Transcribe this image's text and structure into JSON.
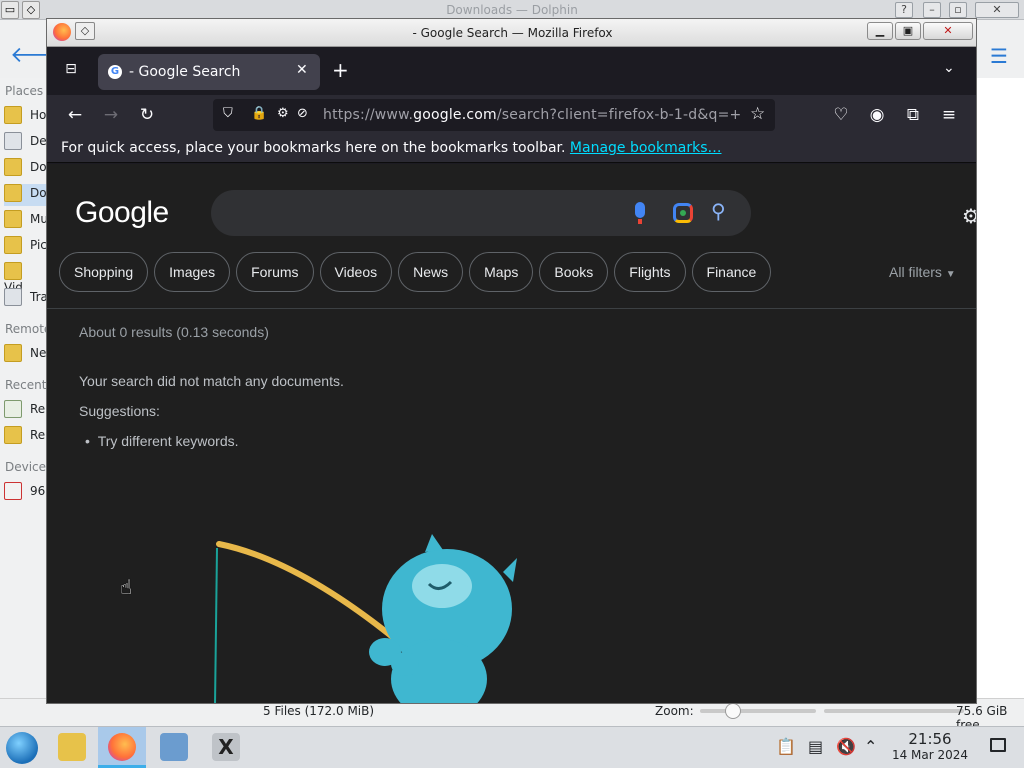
{
  "dolphin": {
    "title": "Downloads — Dolphin",
    "places_header": "Places",
    "remote_header": "Remote",
    "recent_header": "Recent",
    "devices_header": "Devices",
    "places": [
      "Ho",
      "De",
      "Do",
      "Do",
      "Mu",
      "Pic",
      "Vid",
      "Tra"
    ],
    "remote": [
      "Ne"
    ],
    "recent": [
      "Re",
      "Re"
    ],
    "devices": [
      "96"
    ],
    "status_files": "5 Files (172.0 MiB)",
    "zoom_label": "Zoom:",
    "free_space": "75.6 GiB free"
  },
  "firefox": {
    "window_title": "- Google Search — Mozilla Firefox",
    "tab_label": "- Google Search",
    "url_prefix": "https://www.",
    "url_domain": "google.com",
    "url_rest": "/search?client=firefox-b-1-d&q=+",
    "bookmarks_message": "For quick access, place your bookmarks here on the bookmarks toolbar.",
    "manage_bookmarks": "Manage bookmarks…"
  },
  "google": {
    "logo": "Google",
    "chips": [
      "Shopping",
      "Images",
      "Forums",
      "Videos",
      "News",
      "Maps",
      "Books",
      "Flights",
      "Finance"
    ],
    "all_filters": "All filters",
    "stats": "About 0 results (0.13 seconds)",
    "no_match": "Your search did not match any documents.",
    "suggestions_label": "Suggestions:",
    "suggestion_1": "Try different keywords."
  },
  "taskbar": {
    "time": "21:56",
    "date": "14 Mar 2024"
  },
  "colors": {
    "firefox_bg": "#1c1b22",
    "google_bg": "#1f1f1f",
    "link": "#00ddff",
    "accent": "#3daee9"
  }
}
